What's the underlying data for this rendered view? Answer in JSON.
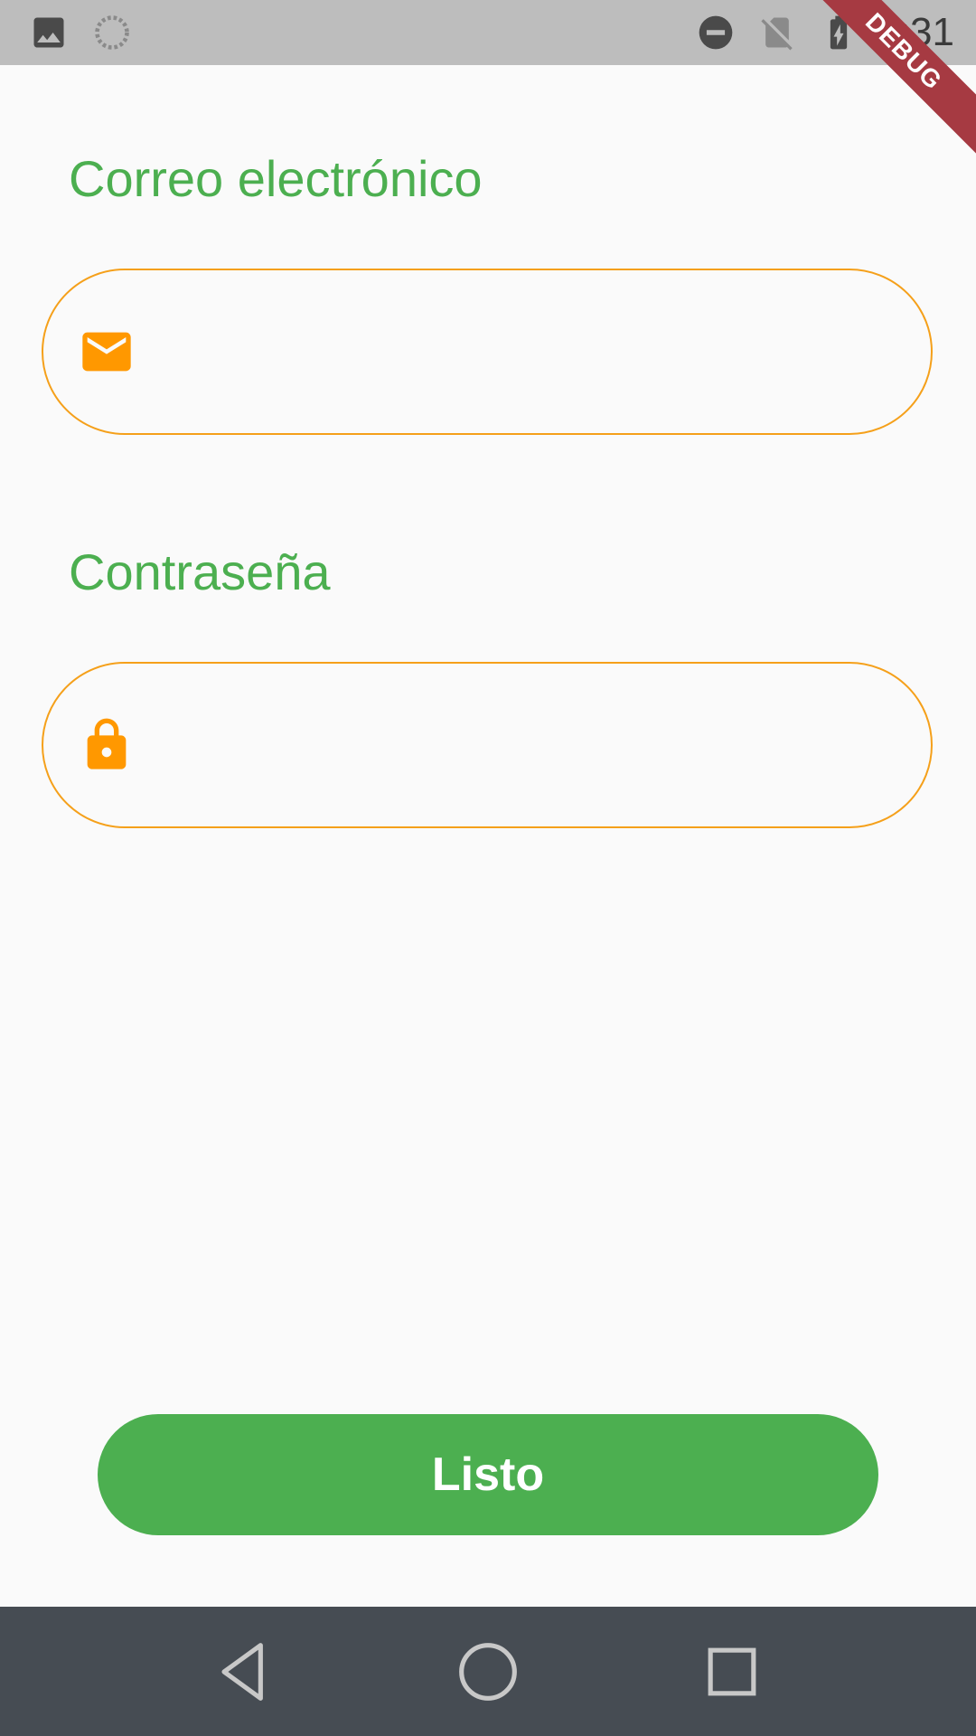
{
  "status_bar": {
    "time": "2:31",
    "left_icons": [
      "image-icon",
      "loading-icon"
    ],
    "right_icons": [
      "do-not-disturb-icon",
      "no-sim-icon",
      "battery-charging-icon"
    ],
    "background": "#bdbdbd"
  },
  "debug_banner": {
    "label": "DEBUG",
    "color": "#a63a42"
  },
  "form": {
    "email": {
      "label": "Correo electrónico",
      "icon": "mail-icon",
      "value": ""
    },
    "password": {
      "label": "Contraseña",
      "icon": "lock-icon",
      "value": ""
    }
  },
  "submit": {
    "label": "Listo"
  },
  "nav_bar": {
    "buttons": [
      "back-icon",
      "home-icon",
      "recents-icon"
    ]
  },
  "colors": {
    "label_green": "#4caf50",
    "accent_orange": "#ff9800",
    "field_border": "#f5a01a",
    "button_green": "#4caf50",
    "nav_background": "#464c53"
  }
}
